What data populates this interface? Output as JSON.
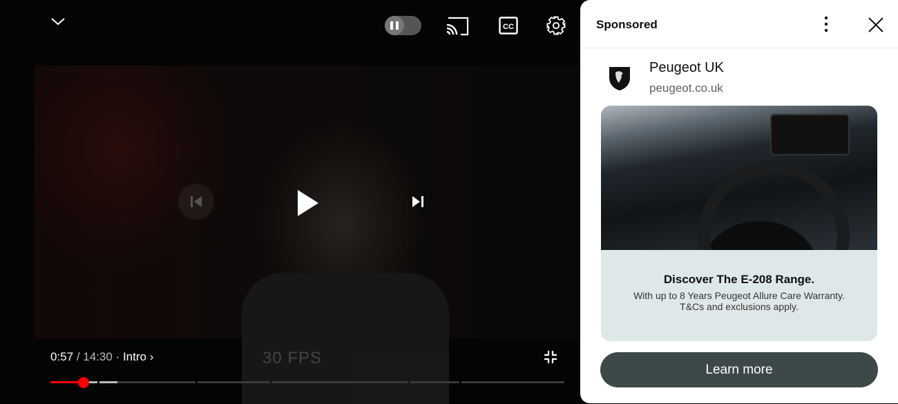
{
  "player": {
    "current_time": "0:57",
    "duration": "14:30",
    "chapter": "Intro",
    "separator": " / ",
    "progress_fraction": 0.066,
    "accent": "#ff0000",
    "shirt_text": "30 FPS",
    "icons": [
      "chevron-down-icon",
      "pause-toggle-icon",
      "cast-icon",
      "closed-captions-icon",
      "settings-icon",
      "previous-icon",
      "play-icon",
      "next-icon",
      "exit-fullscreen-icon"
    ]
  },
  "ad": {
    "header": "Sponsored",
    "advertiser": "Peugeot UK",
    "domain": "peugeot.co.uk",
    "headline": "Discover The E-208 Range.",
    "body_line1": "With up to 8 Years Peugeot Allure Care Warranty.",
    "body_line2": "T&Cs and exclusions apply.",
    "cta": "Learn more",
    "cta_color": "#3d4948"
  }
}
